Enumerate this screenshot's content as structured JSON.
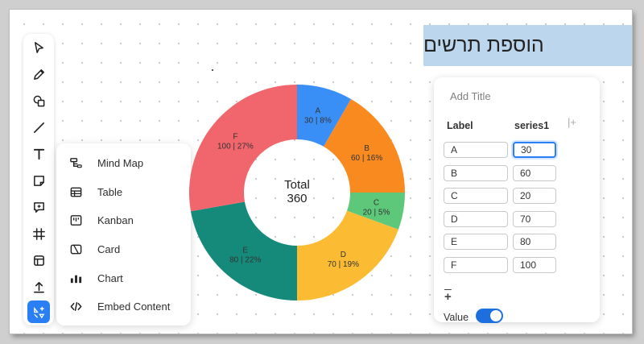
{
  "banner": {
    "text": "הוספת תרשים"
  },
  "toolbar": {
    "tools": [
      {
        "icon": "pointer-icon"
      },
      {
        "icon": "pen-icon"
      },
      {
        "icon": "shapes-icon"
      },
      {
        "icon": "line-icon"
      },
      {
        "icon": "text-icon"
      },
      {
        "icon": "sticky-note-icon"
      },
      {
        "icon": "comment-icon"
      },
      {
        "icon": "frame-icon"
      },
      {
        "icon": "layout-icon"
      },
      {
        "icon": "upload-icon"
      },
      {
        "icon": "more-tools-icon"
      }
    ]
  },
  "menu": {
    "items": [
      {
        "label": "Mind Map",
        "icon": "mind-map-icon"
      },
      {
        "label": "Table",
        "icon": "table-icon"
      },
      {
        "label": "Kanban",
        "icon": "kanban-icon"
      },
      {
        "label": "Card",
        "icon": "card-icon"
      },
      {
        "label": "Chart",
        "icon": "chart-icon"
      },
      {
        "label": "Embed Content",
        "icon": "embed-icon"
      }
    ]
  },
  "chart_data": {
    "type": "pie",
    "title": "",
    "center_label": "Total",
    "center_value": "360",
    "categories": [
      "A",
      "B",
      "C",
      "D",
      "E",
      "F"
    ],
    "values": [
      30,
      60,
      20,
      70,
      80,
      100
    ],
    "percent_labels": [
      "8%",
      "16%",
      "5%",
      "19%",
      "22%",
      "27%"
    ],
    "colors": [
      "#3a8ff7",
      "#f98a1f",
      "#5ec87a",
      "#fbbc33",
      "#168a7a",
      "#f0666c"
    ]
  },
  "panel": {
    "add_title": "Add Title",
    "label_header": "Label",
    "series_header": "series1",
    "add_column": "|+",
    "add_row": "+",
    "value_label": "Value",
    "value_toggle_on": true
  }
}
